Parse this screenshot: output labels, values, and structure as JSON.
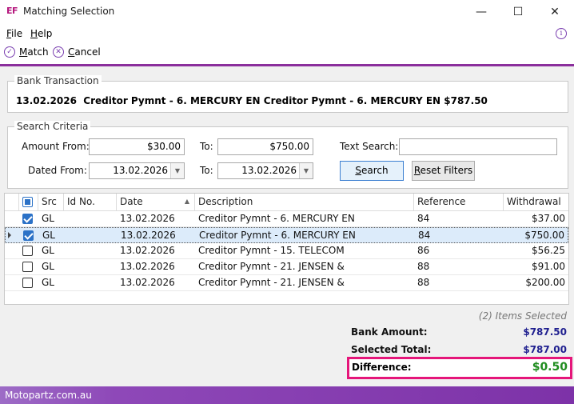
{
  "window": {
    "logo": "EF",
    "title": "Matching Selection",
    "min": "—",
    "max": "☐",
    "close": "✕"
  },
  "menu": {
    "file_u": "F",
    "file_rest": "ile",
    "help_u": "H",
    "help_rest": "elp",
    "info": "i"
  },
  "toolbar": {
    "match_u": "M",
    "match_rest": "atch",
    "cancel_u": "C",
    "cancel_rest": "ancel"
  },
  "bank_transaction": {
    "group_title": "Bank Transaction",
    "text": "13.02.2026  Creditor Pymnt - 6. MERCURY EN Creditor Pymnt - 6. MERCURY EN $787.50"
  },
  "search_criteria": {
    "group_title": "Search Criteria",
    "amount_from_label": "Amount From:",
    "amount_from_value": "$30.00",
    "amount_to_label": "To:",
    "amount_to_value": "$750.00",
    "text_search_label": "Text Search:",
    "text_search_value": "",
    "dated_from_label": "Dated From:",
    "dated_from_value": "13.02.2026",
    "dated_to_label": "To:",
    "dated_to_value": "13.02.2026",
    "search_u": "S",
    "search_rest": "earch",
    "reset_u": "R",
    "reset_rest": "eset Filters"
  },
  "grid": {
    "columns": {
      "src": "Src",
      "id_no": "Id No.",
      "date": "Date",
      "description": "Description",
      "reference": "Reference",
      "withdrawal": "Withdrawal"
    },
    "sort_indicator": "▲",
    "rows": [
      {
        "checked": true,
        "src": "GL",
        "id_no": "",
        "date": "13.02.2026",
        "description": "Creditor Pymnt - 6. MERCURY EN",
        "reference": "84",
        "withdrawal": "$37.00"
      },
      {
        "checked": true,
        "src": "GL",
        "id_no": "",
        "date": "13.02.2026",
        "description": "Creditor Pymnt - 6. MERCURY EN",
        "reference": "84",
        "withdrawal": "$750.00"
      },
      {
        "checked": false,
        "src": "GL",
        "id_no": "",
        "date": "13.02.2026",
        "description": "Creditor Pymnt - 15. TELECOM",
        "reference": "86",
        "withdrawal": "$56.25"
      },
      {
        "checked": false,
        "src": "GL",
        "id_no": "",
        "date": "13.02.2026",
        "description": "Creditor Pymnt - 21. JENSEN &",
        "reference": "88",
        "withdrawal": "$91.00"
      },
      {
        "checked": false,
        "src": "GL",
        "id_no": "",
        "date": "13.02.2026",
        "description": "Creditor Pymnt - 21. JENSEN &",
        "reference": "88",
        "withdrawal": "$200.00"
      }
    ]
  },
  "summary": {
    "items_selected": "(2) Items Selected",
    "bank_amount_label": "Bank Amount:",
    "bank_amount_value": "$787.50",
    "selected_total_label": "Selected Total:",
    "selected_total_value": "$787.00",
    "difference_label": "Difference:",
    "difference_value": "$0.50"
  },
  "colors": {
    "accent": "#8b2f9c",
    "difference_highlight": "#e5167a",
    "difference_value": "#1e8c1e",
    "amount_value": "#1f1f8f"
  },
  "status": {
    "company": "Motopartz.com.au"
  }
}
